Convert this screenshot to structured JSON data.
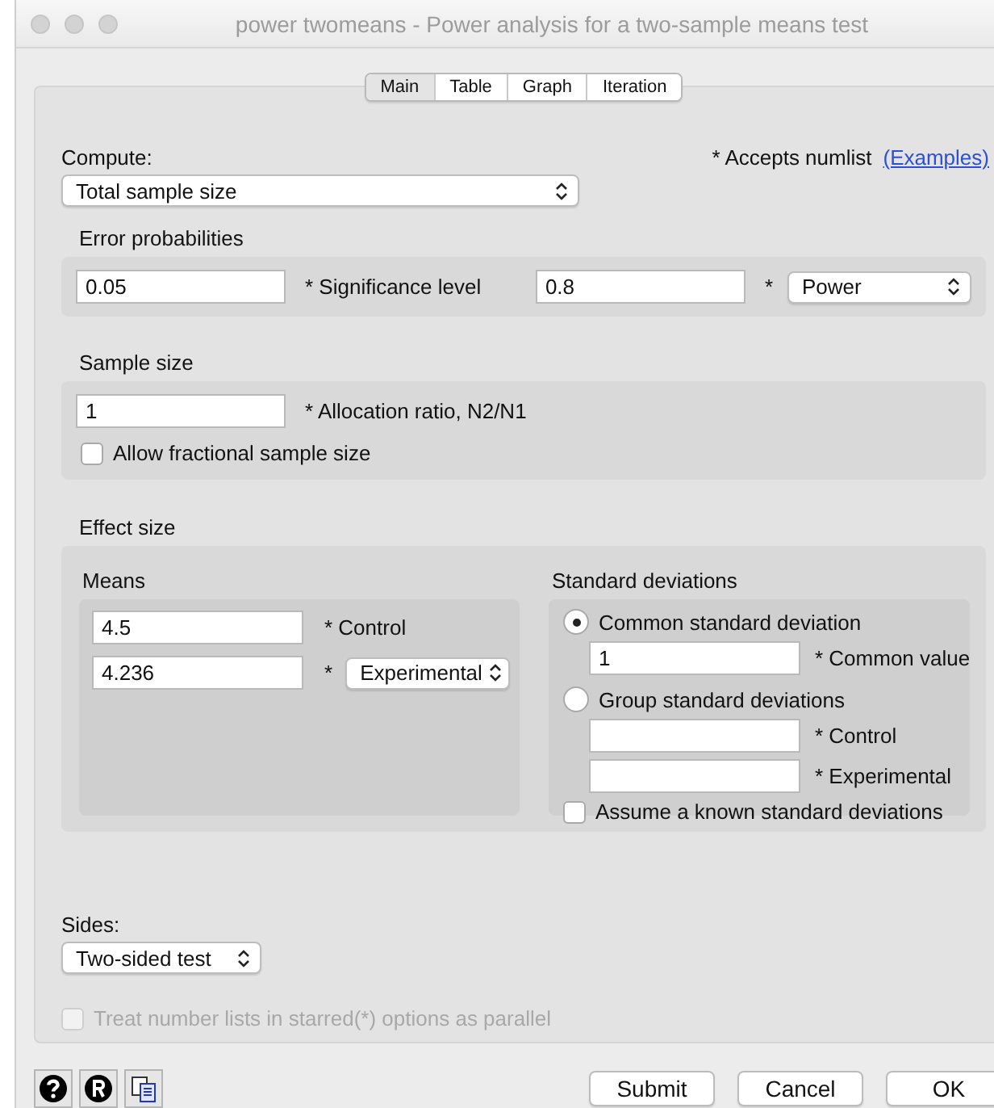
{
  "window": {
    "title": "power twomeans - Power analysis for a two-sample means test"
  },
  "tabs": [
    {
      "label": "Main",
      "selected": true
    },
    {
      "label": "Table",
      "selected": false
    },
    {
      "label": "Graph",
      "selected": false
    },
    {
      "label": "Iteration",
      "selected": false
    }
  ],
  "compute": {
    "label": "Compute:",
    "value": "Total sample size"
  },
  "numlist_note": {
    "text": "* Accepts numlist",
    "link": "(Examples)"
  },
  "error_probabilities": {
    "title": "Error probabilities",
    "alpha": {
      "value": "0.05",
      "label": "* Significance level"
    },
    "power": {
      "value": "0.8",
      "star": "*",
      "select": "Power"
    }
  },
  "sample_size": {
    "title": "Sample size",
    "ratio": {
      "value": "1",
      "label": "* Allocation ratio, N2/N1"
    },
    "fractional": {
      "label": "Allow fractional sample size",
      "checked": false
    }
  },
  "effect_size": {
    "title": "Effect size",
    "means": {
      "title": "Means",
      "control": {
        "value": "4.5",
        "label": "* Control"
      },
      "experimental": {
        "value": "4.236",
        "star": "*",
        "select": "Experimental"
      }
    },
    "std_deviations": {
      "title": "Standard deviations",
      "options": [
        {
          "label": "Common standard deviation",
          "selected": true
        },
        {
          "label": "Group standard deviations",
          "selected": false
        }
      ],
      "common": {
        "value": "1",
        "label": "* Common value"
      },
      "group": [
        {
          "label": "* Control"
        },
        {
          "label": "* Experimental"
        }
      ],
      "known": {
        "label": "Assume a known standard deviations",
        "checked": false
      }
    }
  },
  "sides": {
    "label": "Sides:",
    "value": "Two-sided test"
  },
  "parallel": {
    "label": "Treat number lists in starred(*) options as parallel",
    "checked": false,
    "disabled": true
  },
  "buttons": [
    "Submit",
    "Cancel",
    "OK"
  ]
}
